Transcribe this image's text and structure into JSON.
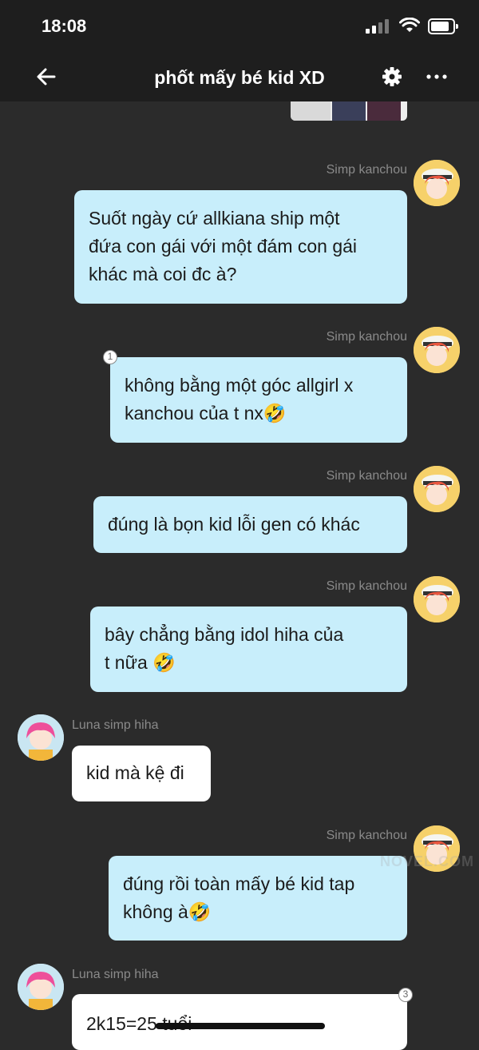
{
  "status_bar": {
    "time": "18:08"
  },
  "header": {
    "title": "phốt mấy bé kid XD"
  },
  "messages": [
    {
      "sender": "Simp kanchou",
      "lines": [
        "Suốt ngày cứ allkiana ship một",
        "đứa con gái với một đám con gái",
        "khác mà coi đc à?"
      ]
    },
    {
      "sender": "Simp kanchou",
      "badge": "1",
      "lines": [
        "không bằng một góc allgirl x",
        "kanchou của t nx🤣"
      ]
    },
    {
      "sender": "Simp kanchou",
      "lines": [
        "đúng là bọn kid lỗi gen có khác"
      ]
    },
    {
      "sender": "Simp kanchou",
      "lines": [
        "bây chẳng bằng idol hiha của",
        "t nữa 🤣"
      ]
    },
    {
      "sender": "Luna simp hiha",
      "lines": [
        "kid mà kệ đi"
      ]
    },
    {
      "sender": "Simp kanchou",
      "lines": [
        "đúng rồi toàn mấy bé kid tap",
        "không à🤣"
      ]
    },
    {
      "sender": "Luna simp hiha",
      "badge": "3",
      "lines": [
        "2k15=25 tuổi"
      ]
    }
  ],
  "watermark": "NOVEL.COM",
  "colors": {
    "background": "#2b2b2b",
    "header": "#1e1e1e",
    "own_bubble": "#c8eefb",
    "other_bubble": "#ffffff",
    "sender_text": "#8a8a8a"
  },
  "icons": [
    "back-arrow-icon",
    "gear-icon",
    "more-dots-icon",
    "signal-icon",
    "wifi-icon",
    "battery-icon"
  ]
}
